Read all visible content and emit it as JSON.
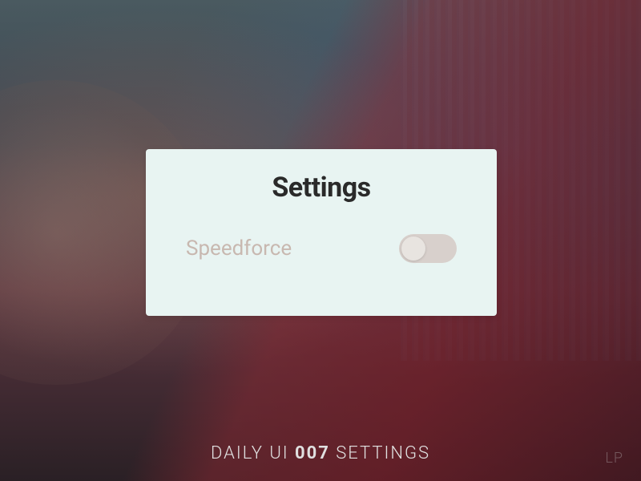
{
  "card": {
    "title": "Settings",
    "setting": {
      "label": "Speedforce",
      "enabled": false
    }
  },
  "footer": {
    "prefix": "DAILY UI ",
    "number": "007",
    "suffix": " SETTINGS"
  },
  "watermark": "LP"
}
